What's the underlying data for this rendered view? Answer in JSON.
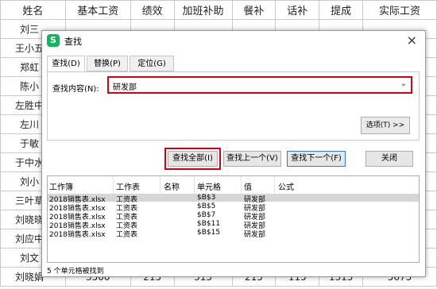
{
  "sheet": {
    "headers": [
      "姓名",
      "基本工资",
      "绩效",
      "加班补助",
      "餐补",
      "话补",
      "提成",
      "实际工资"
    ],
    "names": [
      "刘三",
      "王小五",
      "郑虹",
      "陈小",
      "左胜中",
      "左川",
      "于敏",
      "于中水",
      "刘小",
      "三叶草",
      "刘晓晓",
      "刘应中",
      "刘文",
      "刘晓娟"
    ],
    "last_row_values": [
      "3500",
      "215",
      "315",
      "215",
      "115",
      "1315",
      "5675"
    ]
  },
  "dialog": {
    "app_icon": "S",
    "title": "查找",
    "close": "×",
    "tabs": [
      "查找(D)",
      "替换(P)",
      "定位(G)"
    ],
    "find_label": "查找内容(N):",
    "find_value": "研发部",
    "dropdown_icon": "⌄",
    "options_button": "选项(T) >>",
    "buttons": {
      "find_all": "查找全部(I)",
      "find_prev": "查找上一个(V)",
      "find_next": "查找下一个(F)",
      "close": "关闭"
    },
    "results_headers": [
      "工作簿",
      "工作表",
      "名称",
      "单元格",
      "值",
      "公式"
    ],
    "results": [
      {
        "book": "2018销售表.xlsx",
        "sheet": "工资表",
        "name": "",
        "cell": "$B$3",
        "value": "研发部",
        "formula": ""
      },
      {
        "book": "2018销售表.xlsx",
        "sheet": "工资表",
        "name": "",
        "cell": "$B$5",
        "value": "研发部",
        "formula": ""
      },
      {
        "book": "2018销售表.xlsx",
        "sheet": "工资表",
        "name": "",
        "cell": "$B$7",
        "value": "研发部",
        "formula": ""
      },
      {
        "book": "2018销售表.xlsx",
        "sheet": "工资表",
        "name": "",
        "cell": "$B$11",
        "value": "研发部",
        "formula": ""
      },
      {
        "book": "2018销售表.xlsx",
        "sheet": "工资表",
        "name": "",
        "cell": "$B$15",
        "value": "研发部",
        "formula": ""
      }
    ],
    "status": "5 个单元格被找到"
  },
  "colors": {
    "highlight_red": "#d4001a",
    "accent_blue": "#2b7bd8",
    "app_green": "#16b35e"
  }
}
